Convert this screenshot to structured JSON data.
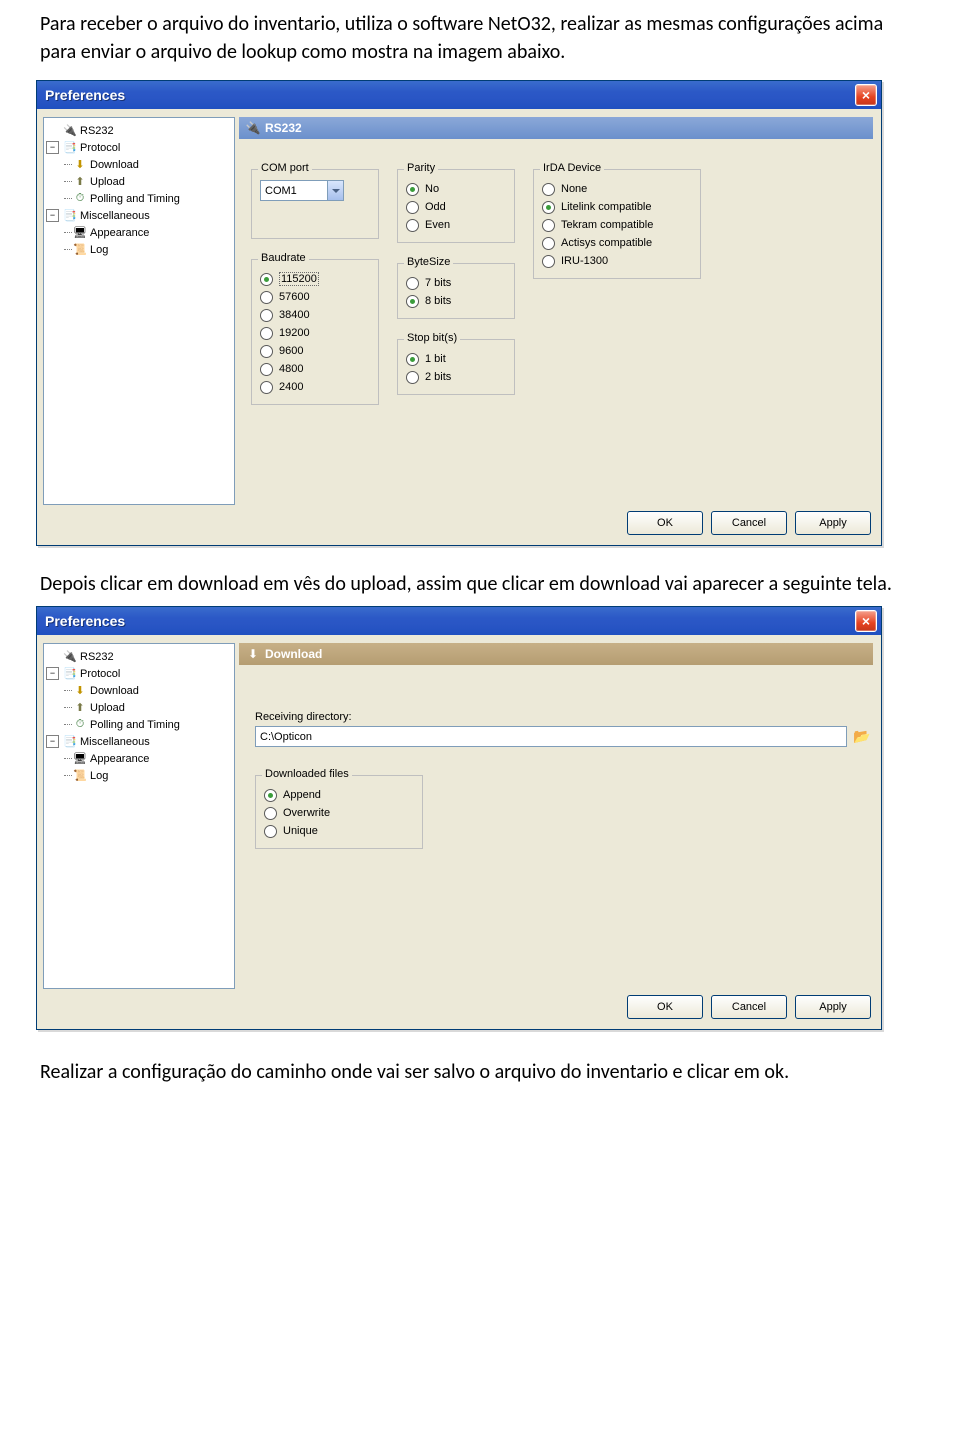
{
  "doc": {
    "p1": "Para receber o arquivo do inventario, utiliza o software NetO32, realizar as mesmas configurações acima para enviar o arquivo de lookup como mostra na imagem abaixo.",
    "p2": "Depois clicar em download em vês do upload, assim que clicar em download vai aparecer a seguinte tela.",
    "p3": "Realizar a configuração do caminho onde vai ser salvo o arquivo do inventario e clicar em ok."
  },
  "dialog": {
    "title": "Preferences",
    "buttons": {
      "ok": "OK",
      "cancel": "Cancel",
      "apply": "Apply"
    }
  },
  "tree": {
    "n0": "RS232",
    "n1": "Protocol",
    "n1a": "Download",
    "n1b": "Upload",
    "n1c": "Polling and Timing",
    "n2": "Miscellaneous",
    "n2a": "Appearance",
    "n2b": "Log"
  },
  "rs232": {
    "section": "RS232",
    "comport": {
      "label": "COM port",
      "value": "COM1"
    },
    "baudrate": {
      "label": "Baudrate",
      "opts": [
        "115200",
        "57600",
        "38400",
        "19200",
        "9600",
        "4800",
        "2400"
      ],
      "sel": 0
    },
    "parity": {
      "label": "Parity",
      "opts": [
        "No",
        "Odd",
        "Even"
      ],
      "sel": 0
    },
    "bytesize": {
      "label": "ByteSize",
      "opts": [
        "7 bits",
        "8 bits"
      ],
      "sel": 1
    },
    "stopbits": {
      "label": "Stop bit(s)",
      "opts": [
        "1 bit",
        "2 bits"
      ],
      "sel": 0
    },
    "irda": {
      "label": "IrDA Device",
      "opts": [
        "None",
        "Litelink compatible",
        "Tekram compatible",
        "Actisys compatible",
        "IRU-1300"
      ],
      "sel": 1
    }
  },
  "download": {
    "section": "Download",
    "recvdir_label": "Receiving directory:",
    "recvdir_value": "C:\\Opticon",
    "files": {
      "label": "Downloaded files",
      "opts": [
        "Append",
        "Overwrite",
        "Unique"
      ],
      "sel": 0
    }
  }
}
